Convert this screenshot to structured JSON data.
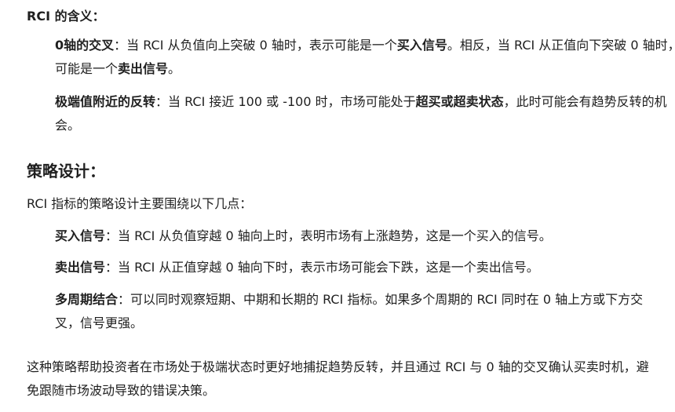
{
  "meaning": {
    "heading": "RCI 的含义：",
    "items": [
      {
        "parts": [
          {
            "text": "0轴的交叉",
            "bold": true
          },
          {
            "text": "：当 RCI 从负值向上突破 0 轴时，表示可能是一个",
            "bold": false
          },
          {
            "text": "买入信号",
            "bold": true
          },
          {
            "text": "。相反，当 RCI 从正值向下突破 0 轴时，可能是一个",
            "bold": false
          },
          {
            "text": "卖出信号",
            "bold": true
          },
          {
            "text": "。",
            "bold": false
          }
        ]
      },
      {
        "parts": [
          {
            "text": "极端值附近的反转",
            "bold": true
          },
          {
            "text": "：当 RCI 接近 100 或 -100 时，市场可能处于",
            "bold": false
          },
          {
            "text": "超买或超卖状态",
            "bold": true
          },
          {
            "text": "，此时可能会有趋势反转的机会。",
            "bold": false
          }
        ]
      }
    ]
  },
  "strategy": {
    "heading": "策略设计：",
    "intro": "RCI 指标的策略设计主要围绕以下几点：",
    "items": [
      {
        "parts": [
          {
            "text": "买入信号",
            "bold": true
          },
          {
            "text": "：当 RCI 从负值穿越 0 轴向上时，表明市场有上涨趋势，这是一个买入的信号。",
            "bold": false
          }
        ]
      },
      {
        "parts": [
          {
            "text": "卖出信号",
            "bold": true
          },
          {
            "text": "：当 RCI 从正值穿越 0 轴向下时，表示市场可能会下跌，这是一个卖出信号。",
            "bold": false
          }
        ]
      },
      {
        "parts": [
          {
            "text": "多周期结合",
            "bold": true
          },
          {
            "text": "：可以同时观察短期、中期和长期的 RCI 指标。如果多个周期的 RCI 同时在 0 轴上方或下方交叉，信号更强。",
            "bold": false
          }
        ]
      }
    ],
    "summary": "这种策略帮助投资者在市场处于极端状态时更好地捕捉趋势反转，并且通过 RCI 与 0 轴的交叉确认买卖时机，避免跟随市场波动导致的错误决策。"
  }
}
